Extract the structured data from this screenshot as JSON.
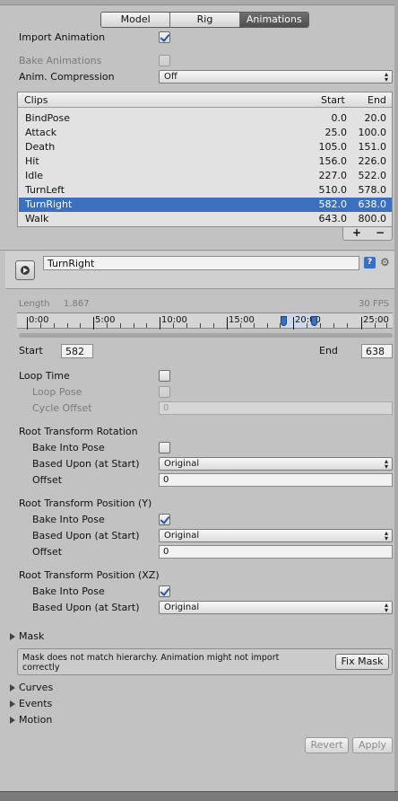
{
  "tabs": [
    {
      "label": "Model"
    },
    {
      "label": "Rig"
    },
    {
      "label": "Animations",
      "active": true
    }
  ],
  "import_animation": {
    "label": "Import Animation",
    "checked": true
  },
  "bake_animations": {
    "label": "Bake Animations",
    "checked": false,
    "disabled": true
  },
  "anim_compression": {
    "label": "Anim. Compression",
    "value": "Off"
  },
  "clips_table": {
    "headers": {
      "clips": "Clips",
      "start": "Start",
      "end": "End"
    },
    "rows": [
      {
        "name": "BindPose",
        "start": "0.0",
        "end": "20.0"
      },
      {
        "name": "Attack",
        "start": "25.0",
        "end": "100.0"
      },
      {
        "name": "Death",
        "start": "105.0",
        "end": "151.0"
      },
      {
        "name": "Hit",
        "start": "156.0",
        "end": "226.0"
      },
      {
        "name": "Idle",
        "start": "227.0",
        "end": "522.0"
      },
      {
        "name": "TurnLeft",
        "start": "510.0",
        "end": "578.0"
      },
      {
        "name": "TurnRight",
        "start": "582.0",
        "end": "638.0",
        "selected": true
      },
      {
        "name": "Walk",
        "start": "643.0",
        "end": "800.0"
      }
    ],
    "add_label": "+",
    "remove_label": "−"
  },
  "clip": {
    "name": "TurnRight",
    "help_label": "?",
    "length_label": "Length",
    "length_value": "1.867",
    "fps": "30 FPS",
    "timeline_ticks": [
      "0:00",
      "5:00",
      "10:00",
      "15:00",
      "20:00",
      "25:00"
    ],
    "start_label": "Start",
    "start_value": "582",
    "end_label": "End",
    "end_value": "638"
  },
  "loop": {
    "loop_time": "Loop Time",
    "loop_pose": "Loop Pose",
    "cycle_offset": "Cycle Offset",
    "cycle_offset_value": "0"
  },
  "root_rotation": {
    "title": "Root Transform Rotation",
    "bake": "Bake Into Pose",
    "bake_checked": false,
    "based_upon": "Based Upon (at Start)",
    "based_value": "Original",
    "offset": "Offset",
    "offset_value": "0"
  },
  "root_pos_y": {
    "title": "Root Transform Position (Y)",
    "bake": "Bake Into Pose",
    "bake_checked": true,
    "based_upon": "Based Upon (at Start)",
    "based_value": "Original",
    "offset": "Offset",
    "offset_value": "0"
  },
  "root_pos_xz": {
    "title": "Root Transform Position (XZ)",
    "bake": "Bake Into Pose",
    "bake_checked": true,
    "based_upon": "Based Upon (at Start)",
    "based_value": "Original"
  },
  "mask": {
    "title": "Mask",
    "warning": "Mask does not match hierarchy. Animation might not import correctly",
    "fix_button": "Fix Mask"
  },
  "foldouts": {
    "curves": "Curves",
    "events": "Events",
    "motion": "Motion"
  },
  "footer": {
    "revert": "Revert",
    "apply": "Apply"
  },
  "colors": {
    "selection": "#3d6fbf",
    "background": "#c2c2c2"
  }
}
